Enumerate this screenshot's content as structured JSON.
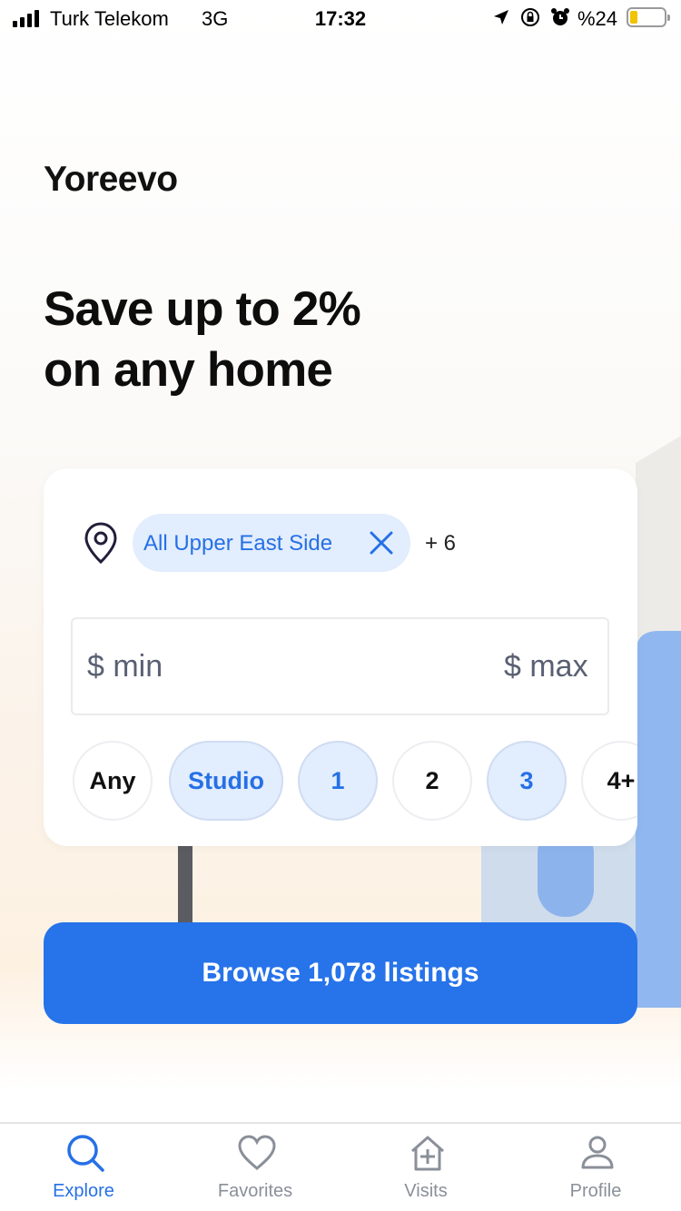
{
  "status_bar": {
    "carrier": "Turk Telekom",
    "network": "3G",
    "time": "17:32",
    "battery": "%24",
    "battery_level": 0.24,
    "icons": [
      "signal-icon",
      "location-arrow-icon",
      "rotation-lock-icon",
      "alarm-icon",
      "battery-icon"
    ]
  },
  "brand": "Yoreevo",
  "hero": {
    "line1": "Save up to 2%",
    "line2": "on any home"
  },
  "search": {
    "location_icon": "map-pin-icon",
    "area_chip": "All Upper East Side",
    "area_chip_remove_icon": "close-icon",
    "more_areas": "+ 6",
    "price_min_placeholder": "$ min",
    "price_max_placeholder": "$ max",
    "bed_options": [
      {
        "label": "Any",
        "selected": false
      },
      {
        "label": "Studio",
        "selected": true
      },
      {
        "label": "1",
        "selected": true
      },
      {
        "label": "2",
        "selected": false
      },
      {
        "label": "3",
        "selected": true
      },
      {
        "label": "4+",
        "selected": false
      }
    ]
  },
  "cta": {
    "label": "Browse 1,078 listings"
  },
  "tabs": [
    {
      "label": "Explore",
      "icon": "search-icon",
      "active": true
    },
    {
      "label": "Favorites",
      "icon": "heart-icon",
      "active": false
    },
    {
      "label": "Visits",
      "icon": "house-plus-icon",
      "active": false
    },
    {
      "label": "Profile",
      "icon": "person-icon",
      "active": false
    }
  ],
  "colors": {
    "accent": "#2673ea",
    "chip_bg": "#e2edfd",
    "chip_text": "#2670e6",
    "inactive_tab": "#8a8f99"
  }
}
